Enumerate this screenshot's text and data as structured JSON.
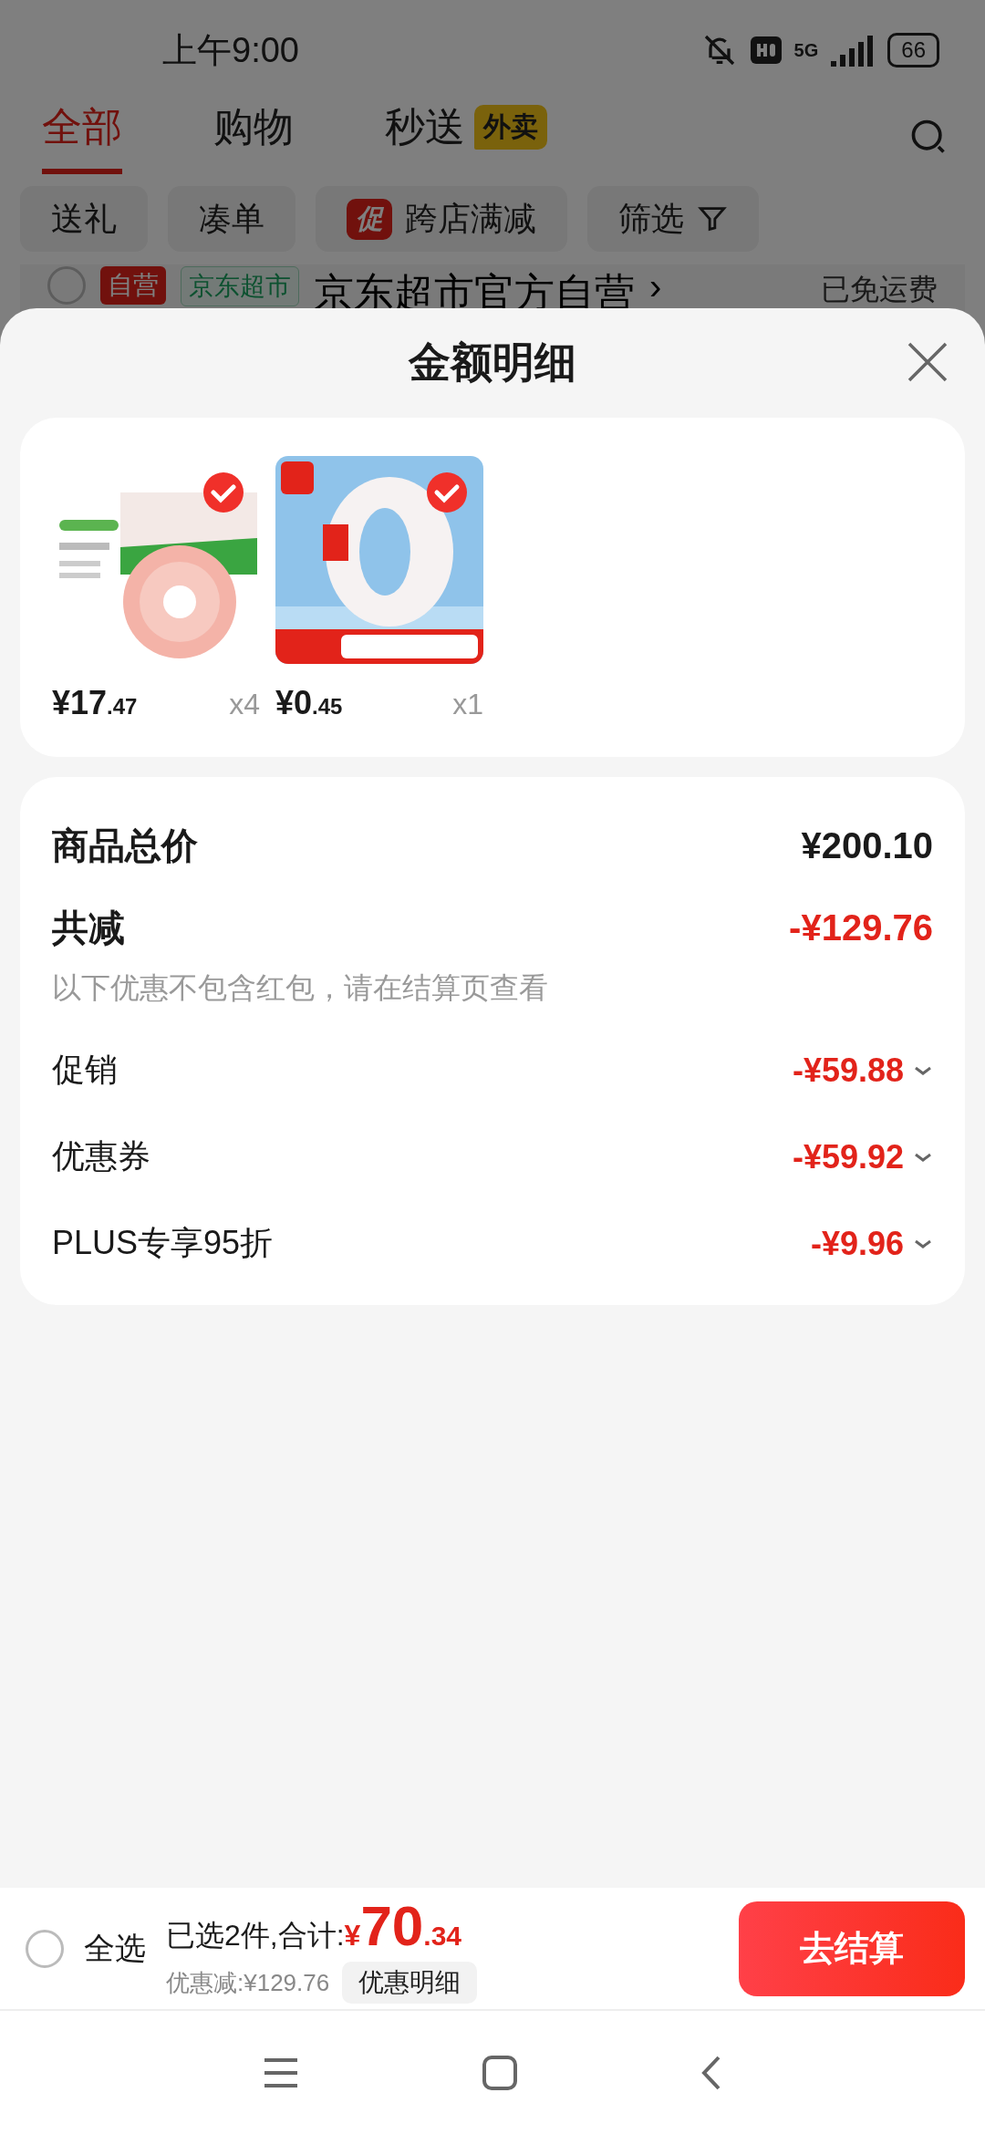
{
  "status_bar": {
    "time": "上午9:00",
    "network": "5G",
    "battery": "66"
  },
  "tabs": [
    {
      "label": "全部",
      "selected": true
    },
    {
      "label": "购物",
      "selected": false
    },
    {
      "label": "秒送",
      "badge": "外卖",
      "selected": false
    }
  ],
  "filters": [
    {
      "label": "送礼",
      "kind": "plain"
    },
    {
      "label": "凑单",
      "kind": "plain"
    },
    {
      "label": "跨店满减",
      "kind": "promo",
      "tag": "促"
    },
    {
      "label": "筛选",
      "kind": "filter"
    }
  ],
  "store": {
    "checked": false,
    "badge": "自营",
    "channel": "京东超市",
    "name": "京东超市官方自营",
    "arrow": "›",
    "shipping": "已免运费"
  },
  "sheet": {
    "title": "金额明细",
    "products": [
      {
        "kind": "meat",
        "price_int": "¥17",
        "price_dec": ".47",
        "qty": "x4",
        "checked": true
      },
      {
        "kind": "tape",
        "price_int": "¥0",
        "price_dec": ".45",
        "qty": "x1",
        "checked": true
      }
    ],
    "summary": {
      "total_label": "商品总价",
      "total": "¥200.10",
      "discount_label": "共减",
      "discount": "-¥129.76",
      "note": "以下优惠不包含红包，请在结算页查看",
      "items": [
        {
          "label": "促销",
          "amount": "-¥59.88"
        },
        {
          "label": "优惠券",
          "amount": "-¥59.92"
        },
        {
          "label": "PLUS专享95折",
          "amount": "-¥9.96"
        }
      ]
    }
  },
  "checkout": {
    "checked": false,
    "select_all": "全选",
    "selected_text": "已选2件,合计:",
    "currency": "¥",
    "total_int": "70",
    "total_dec": ".34",
    "saving": "优惠减:¥129.76",
    "detail_button": "优惠明细",
    "submit": "去结算"
  }
}
